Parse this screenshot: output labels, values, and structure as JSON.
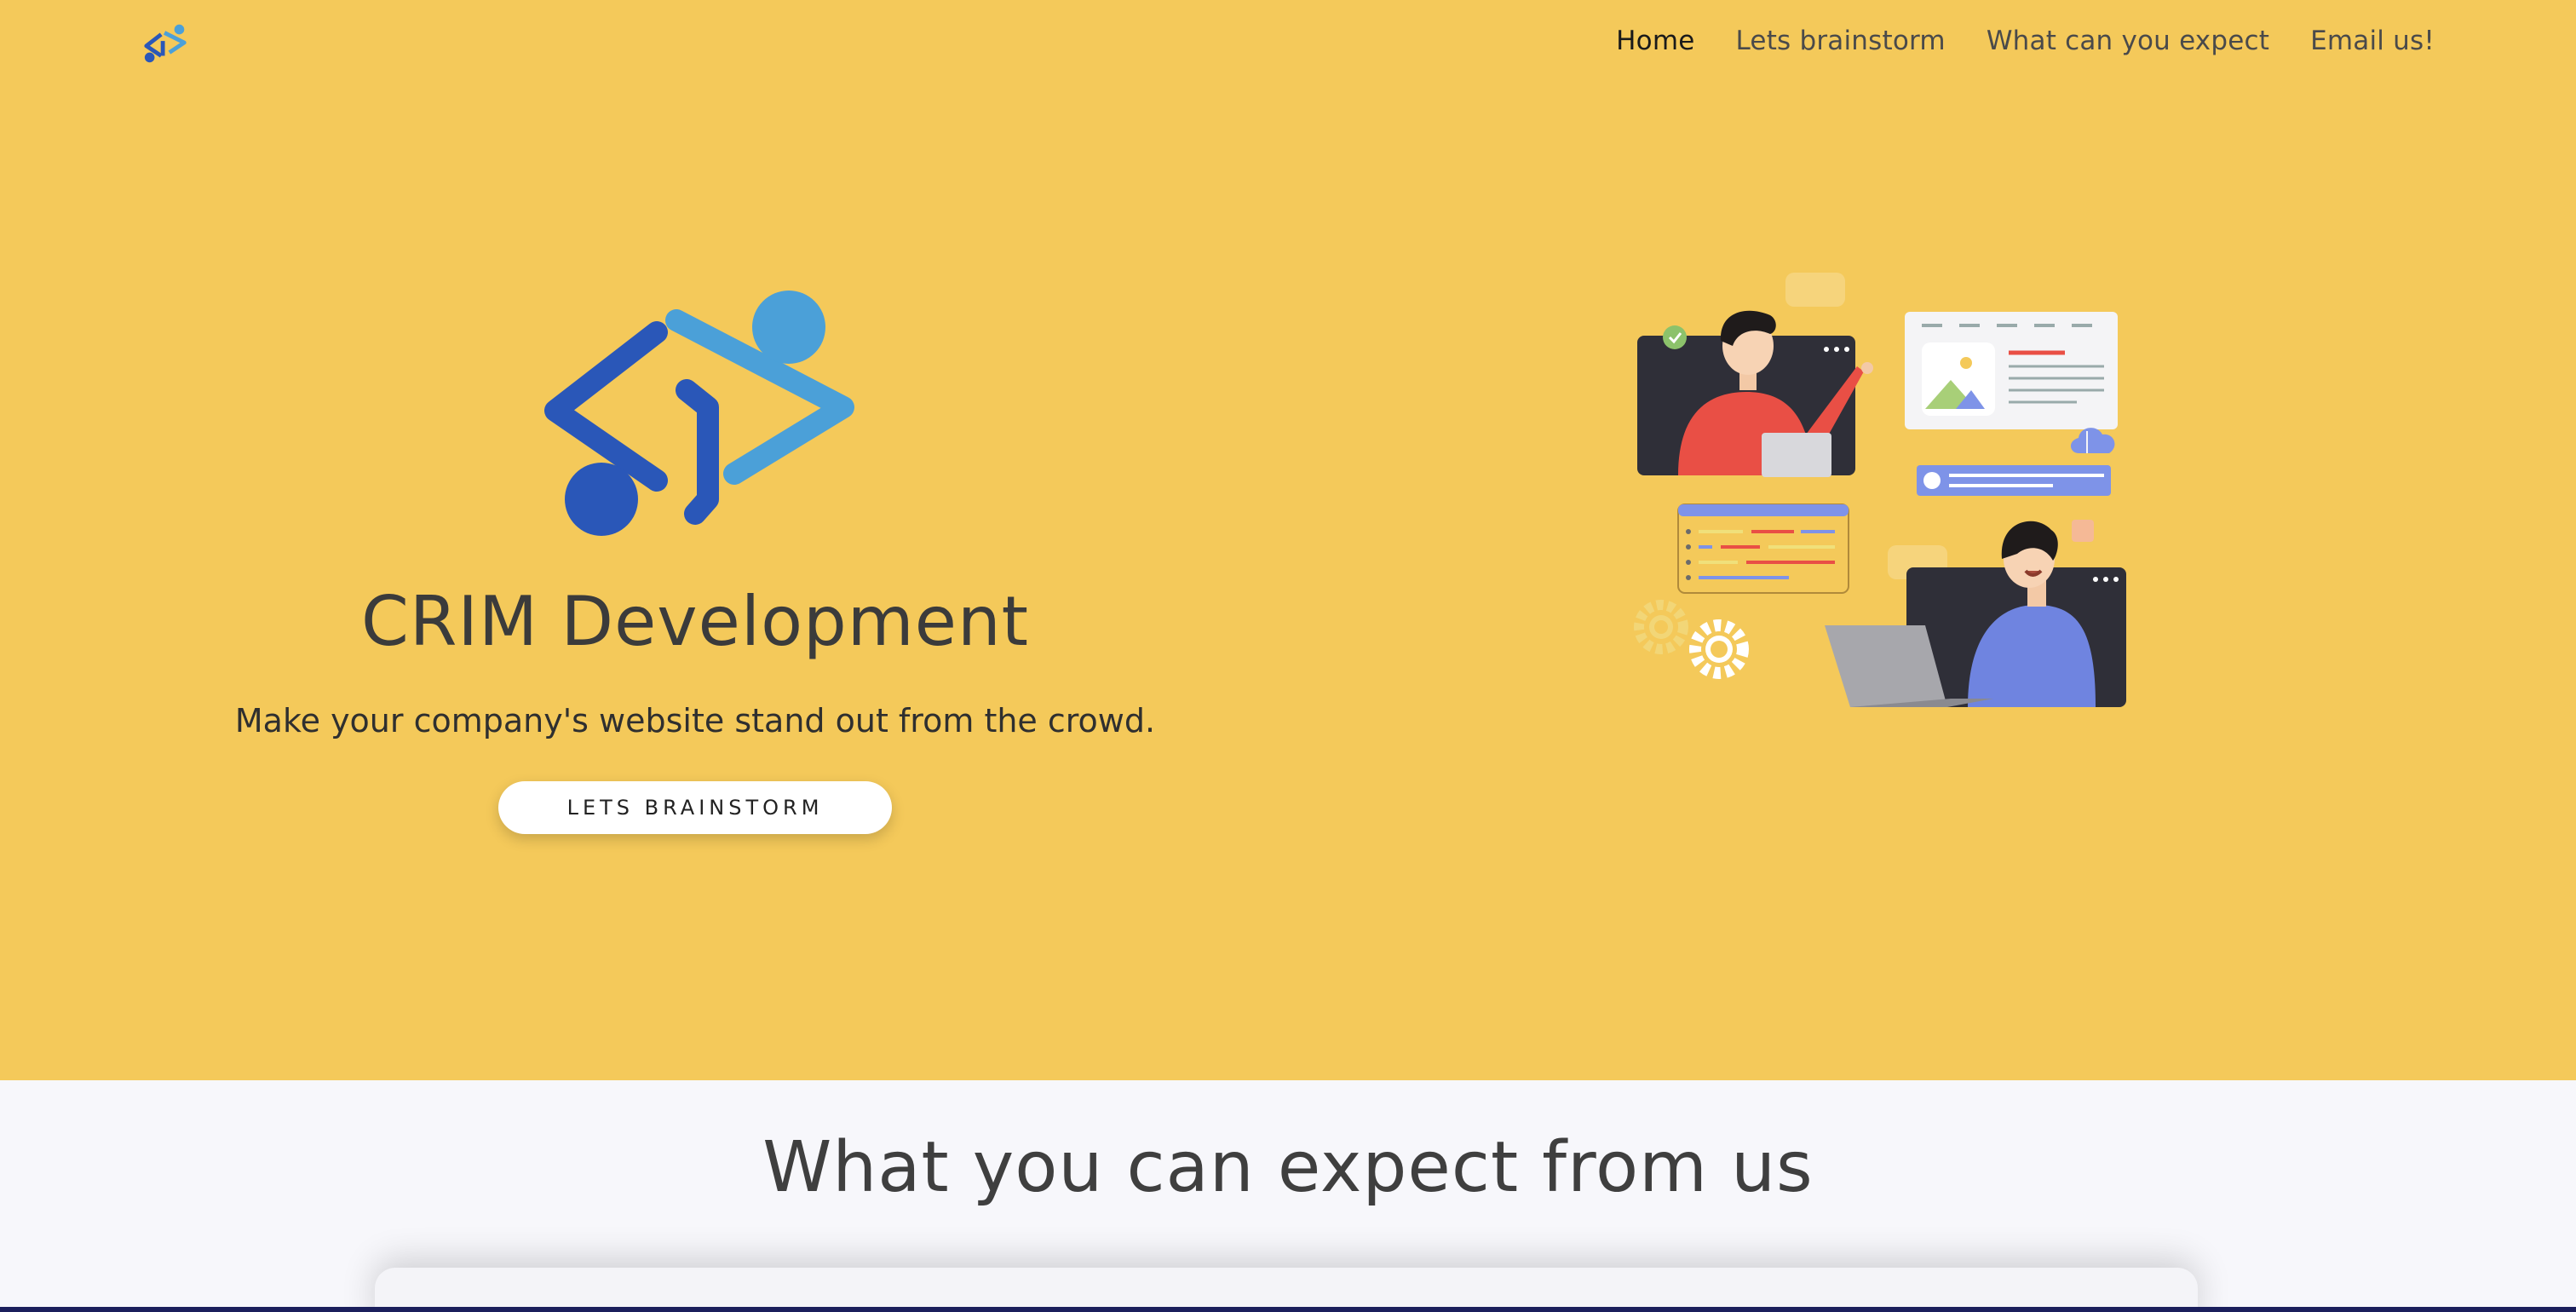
{
  "nav": {
    "logo_icon": "crim-logo-icon",
    "links": [
      {
        "label": "Home",
        "active": true
      },
      {
        "label": "Lets brainstorm",
        "active": false
      },
      {
        "label": "What can you expect",
        "active": false
      },
      {
        "label": "Email us!",
        "active": false
      }
    ]
  },
  "hero": {
    "logo_icon": "crim-logo-icon",
    "title": "CRIM Development",
    "subtitle": "Make your company's website stand out from the crowd.",
    "cta_label": "LETS BRAINSTORM",
    "illustration_icon": "team-collaboration-illustration"
  },
  "section": {
    "title": "What you can expect from us"
  },
  "colors": {
    "background": "#f4c95a",
    "logo_dark_blue": "#2a57b8",
    "logo_light_blue": "#4ba0d8",
    "section_bg": "#f7f7fb",
    "text": "#3b3b3b"
  }
}
